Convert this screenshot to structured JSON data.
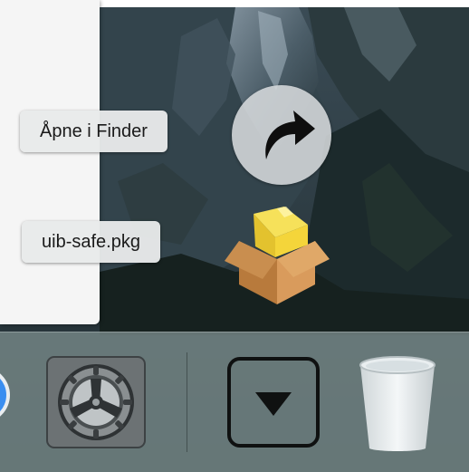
{
  "stack": {
    "items": [
      {
        "label": "Åpne i Finder",
        "icon": "arrow-curve-right-icon"
      },
      {
        "label": "uib-safe.pkg",
        "icon": "package-box-icon"
      }
    ]
  },
  "dock": {
    "items": [
      {
        "icon": "safari-compass-icon"
      },
      {
        "icon": "system-preferences-gear-icon"
      },
      {
        "icon": "downloads-stack-icon"
      },
      {
        "icon": "trash-icon"
      }
    ]
  },
  "colors": {
    "dock_background": "#728383",
    "label_background": "#e8eaea",
    "safari_blue": "#3a8ef0",
    "package_yellow": "#f4d53a",
    "package_brown": "#c98e4f"
  }
}
